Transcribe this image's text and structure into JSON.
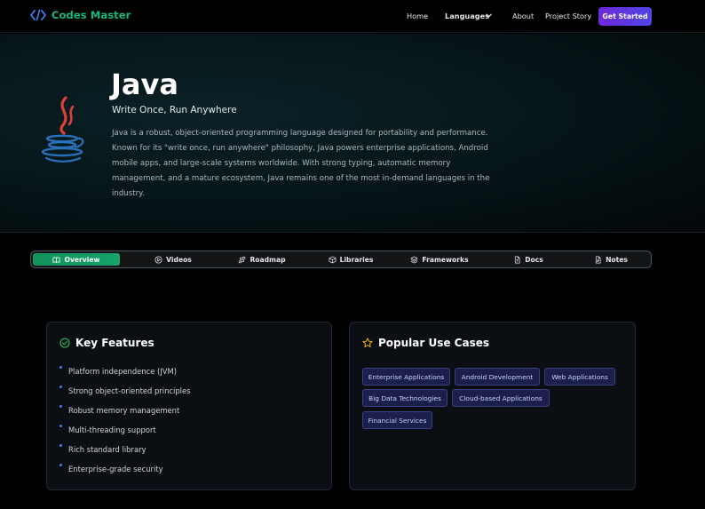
{
  "brand": {
    "name": "Codes Master",
    "icon": "code-brackets-icon"
  },
  "nav": {
    "home": "Home",
    "languages": "Languages",
    "about": "About",
    "project_story": "Project Story",
    "cta": "Get Started"
  },
  "hero": {
    "title": "Java",
    "subtitle": "Write Once, Run Anywhere",
    "description": "Java is a robust, object-oriented programming language designed for portability and performance. Known for its \"write once, run anywhere\" philosophy, Java powers enterprise applications, Android mobile apps, and large-scale systems worldwide. With strong typing, automatic memory management, and a mature ecosystem, Java remains one of the most in-demand languages in the industry."
  },
  "tabs": [
    {
      "label": "Overview",
      "icon": "book-open-icon",
      "active": true
    },
    {
      "label": "Videos",
      "icon": "play-circle-icon",
      "active": false
    },
    {
      "label": "Roadmap",
      "icon": "roadmap-icon",
      "active": false
    },
    {
      "label": "Libraries",
      "icon": "package-icon",
      "active": false
    },
    {
      "label": "Frameworks",
      "icon": "layers-icon",
      "active": false
    },
    {
      "label": "Docs",
      "icon": "document-icon",
      "active": false
    },
    {
      "label": "Notes",
      "icon": "notes-icon",
      "active": false
    }
  ],
  "features": {
    "title": "Key Features",
    "icon": "check-circle-icon",
    "items": [
      "Platform independence (JVM)",
      "Strong object-oriented principles",
      "Robust memory management",
      "Multi-threading support",
      "Rich standard library",
      "Enterprise-grade security"
    ]
  },
  "use_cases": {
    "title": "Popular Use Cases",
    "icon": "star-icon",
    "items": [
      "Enterprise Applications",
      "Android Development",
      "Web Applications",
      "Big Data Technologies",
      "Cloud-based Applications",
      "Financial Services"
    ]
  },
  "colors": {
    "accent_green": "#10b981",
    "cta_gradient_start": "#6d28d9",
    "cta_gradient_end": "#4f46e5",
    "chip_bg": "#1b1f4a",
    "bullet_blue": "#3b82f6"
  }
}
